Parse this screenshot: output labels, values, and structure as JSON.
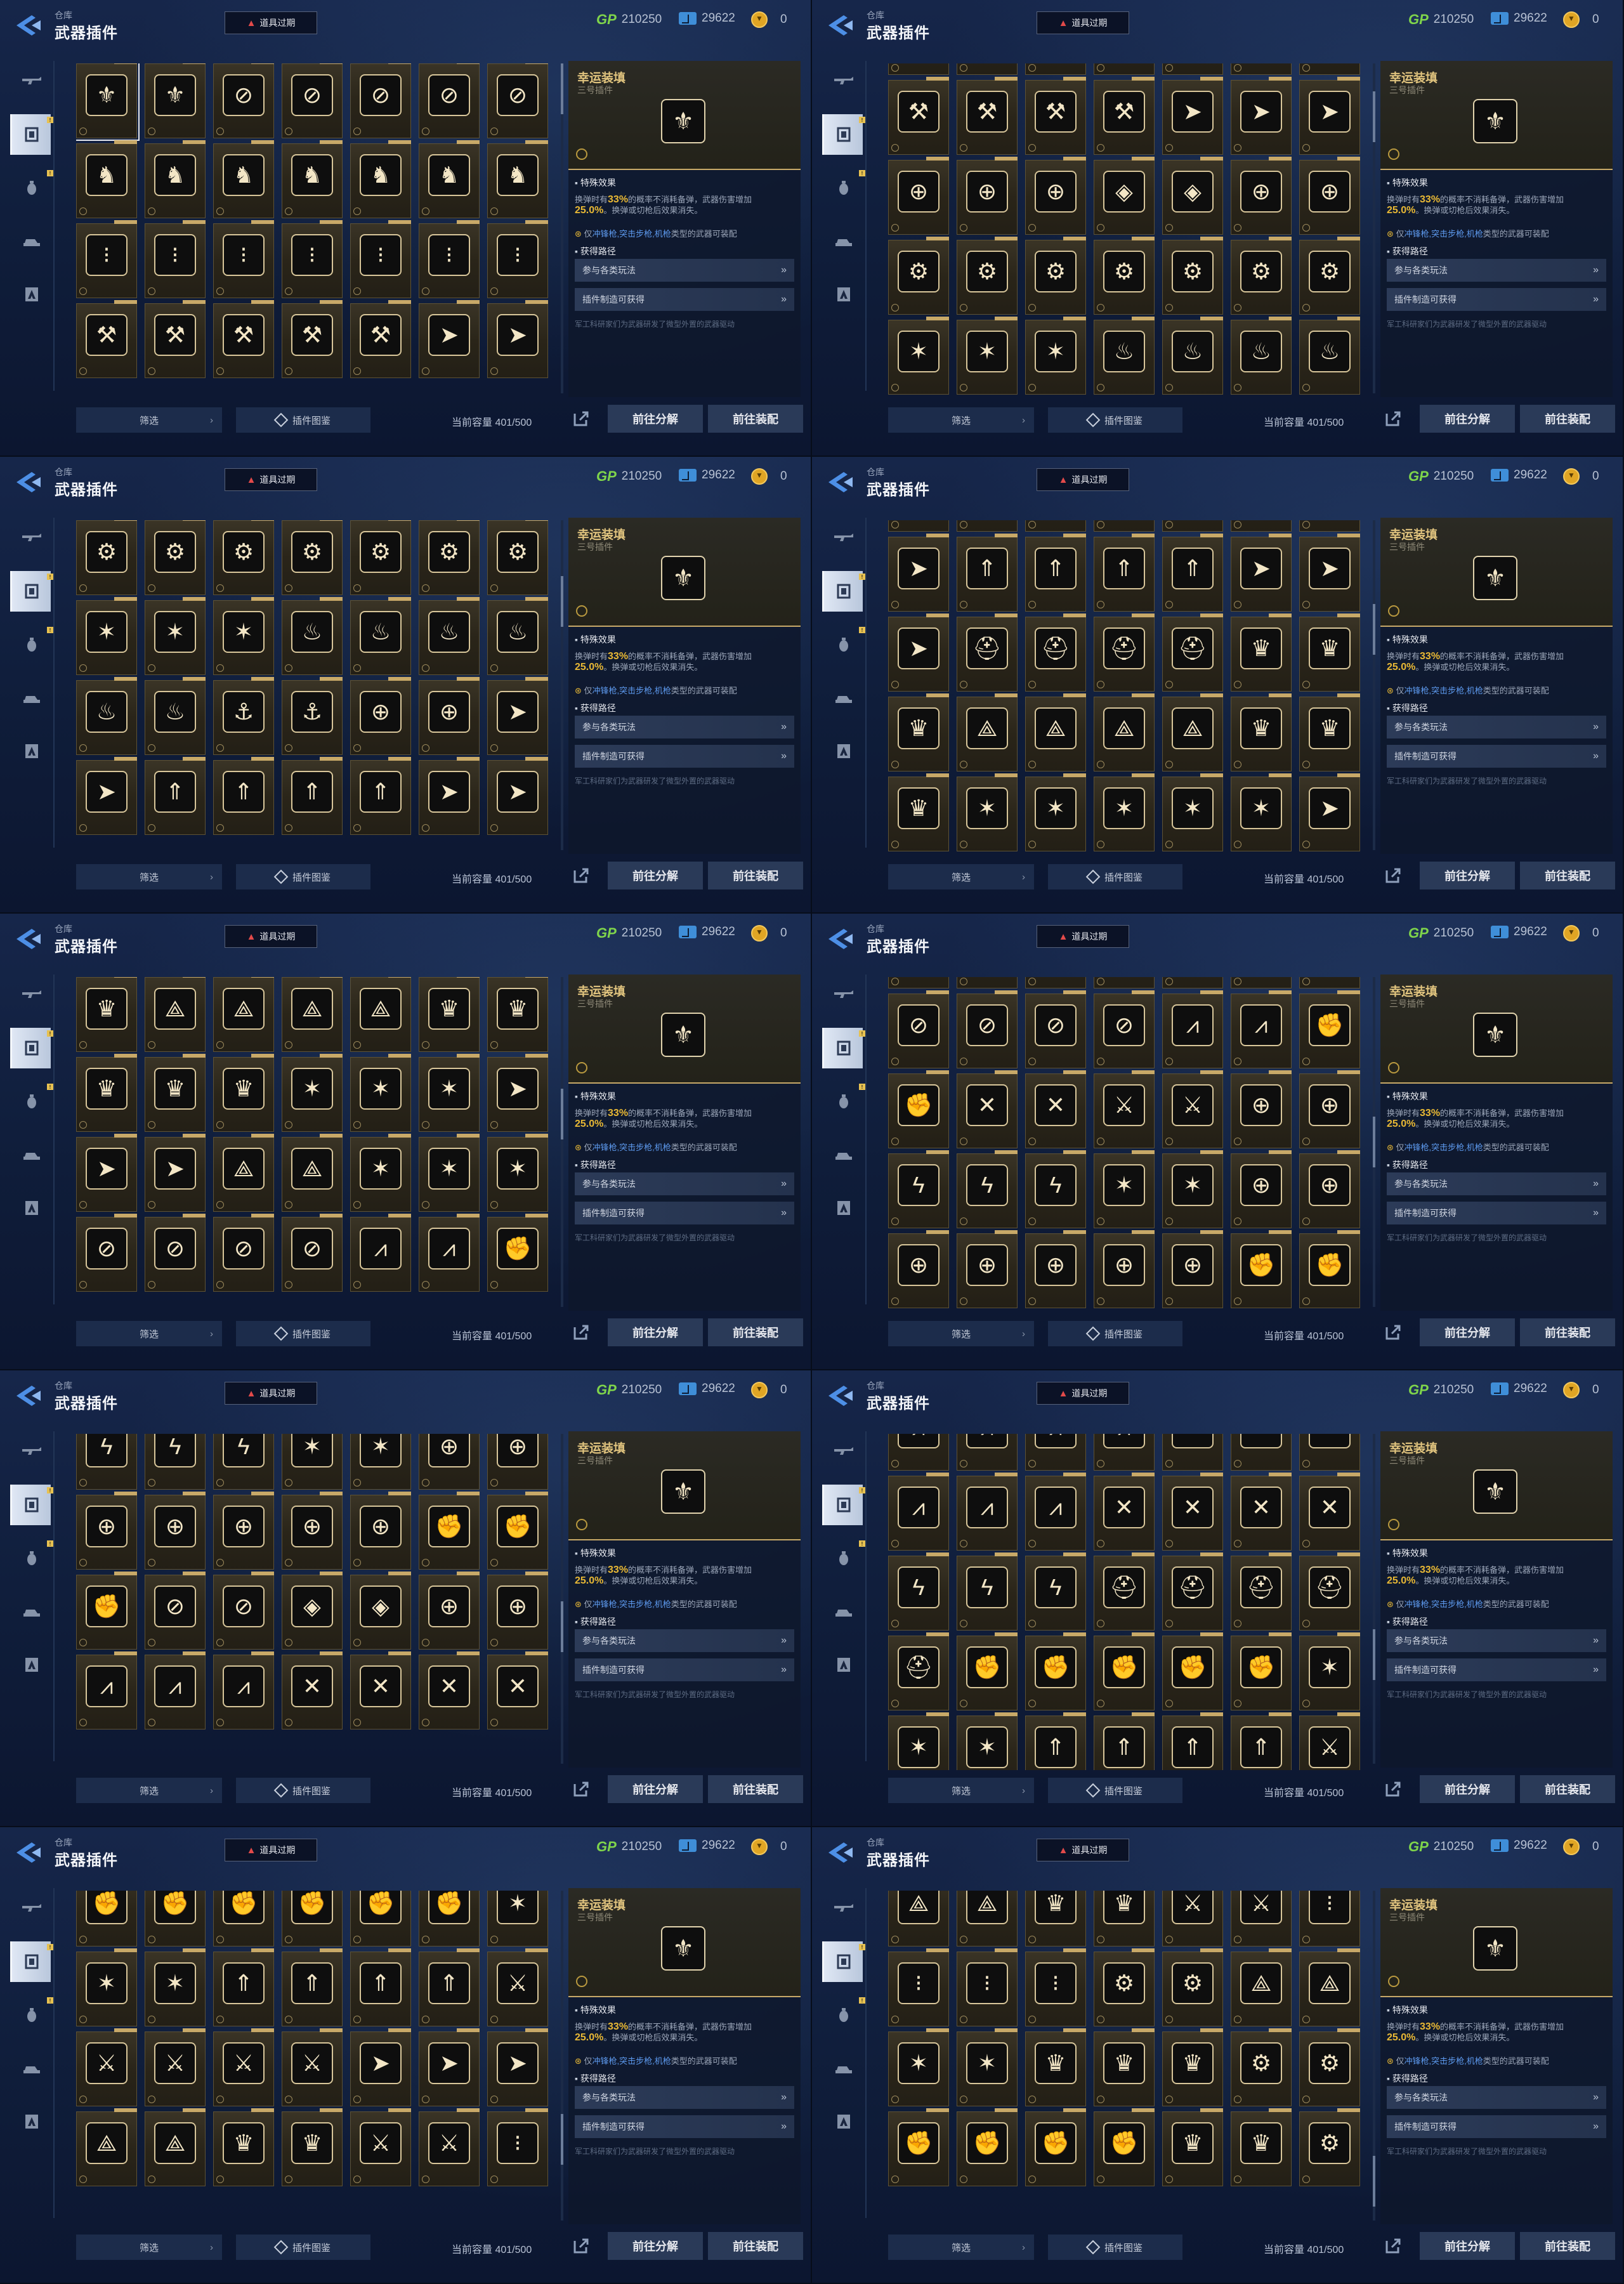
{
  "header": {
    "breadcrumb": "仓库",
    "title": "武器插件",
    "expired_label": "道具过期",
    "gp_label": "GP",
    "gp_value": "210250",
    "ticket_value": "29622",
    "coin_value": "0"
  },
  "sidebar": {
    "badge": "!",
    "tabs": [
      {
        "icon": "rifle-icon"
      },
      {
        "icon": "plugin-chip-icon"
      },
      {
        "icon": "grenade-icon"
      },
      {
        "icon": "vehicle-icon"
      },
      {
        "icon": "emblem-icon"
      }
    ]
  },
  "glyphs": {
    "wing": "⚜",
    "shield": "⊘",
    "soldier": "♞",
    "bullets": "⁝",
    "gun": "⚒",
    "arrow": "➤",
    "target": "⊕",
    "diamond": "◈",
    "robot": "⚙",
    "star": "✶",
    "flame": "♨",
    "anchor": "⚓",
    "chevron": "⇑",
    "helmet": "⛑",
    "triangle": "⟁",
    "claw": "⩘",
    "cross": "✕",
    "bolt": "ϟ",
    "fist": "✊",
    "sword": "⚔",
    "crown": "♛"
  },
  "panels": [
    {
      "offset": 0,
      "selected": 0,
      "scroll": 0.0,
      "icons": [
        "wing",
        "wing",
        "shield",
        "shield",
        "shield",
        "shield",
        "shield",
        "soldier",
        "soldier",
        "soldier",
        "soldier",
        "soldier",
        "soldier",
        "soldier",
        "bullets",
        "bullets",
        "bullets",
        "bullets",
        "bullets",
        "bullets",
        "bullets",
        "gun",
        "gun",
        "gun",
        "gun",
        "gun",
        "arrow",
        "arrow"
      ]
    },
    {
      "offset": -100,
      "selected": -1,
      "scroll": 0.1,
      "icons": [
        "robot",
        "robot",
        "robot",
        "robot",
        "robot",
        "robot",
        "robot",
        "gun",
        "gun",
        "gun",
        "gun",
        "arrow",
        "arrow",
        "arrow",
        "target",
        "target",
        "target",
        "diamond",
        "diamond",
        "target",
        "target",
        "robot",
        "robot",
        "robot",
        "robot",
        "robot",
        "robot",
        "robot",
        "star",
        "star",
        "star",
        "flame",
        "flame",
        "flame",
        "flame"
      ]
    },
    {
      "offset": 0,
      "selected": -1,
      "scroll": 0.2,
      "icons": [
        "robot",
        "robot",
        "robot",
        "robot",
        "robot",
        "robot",
        "robot",
        "star",
        "star",
        "star",
        "flame",
        "flame",
        "flame",
        "flame",
        "flame",
        "flame",
        "anchor",
        "anchor",
        "target",
        "target",
        "arrow",
        "arrow",
        "chevron",
        "chevron",
        "chevron",
        "chevron",
        "arrow",
        "arrow"
      ]
    },
    {
      "offset": -100,
      "selected": -1,
      "scroll": 0.3,
      "icons": [
        "flame",
        "flame",
        "flame",
        "flame",
        "flame",
        "flame",
        "flame",
        "arrow",
        "chevron",
        "chevron",
        "chevron",
        "chevron",
        "arrow",
        "arrow",
        "arrow",
        "helmet",
        "helmet",
        "helmet",
        "helmet",
        "crown",
        "crown",
        "crown",
        "triangle",
        "triangle",
        "triangle",
        "triangle",
        "crown",
        "crown",
        "crown",
        "star",
        "star",
        "star",
        "star",
        "star",
        "arrow"
      ]
    },
    {
      "offset": 0,
      "selected": -1,
      "scroll": 0.4,
      "icons": [
        "crown",
        "triangle",
        "triangle",
        "triangle",
        "triangle",
        "crown",
        "crown",
        "crown",
        "crown",
        "crown",
        "star",
        "star",
        "star",
        "arrow",
        "arrow",
        "arrow",
        "triangle",
        "triangle",
        "star",
        "star",
        "star",
        "shield",
        "shield",
        "shield",
        "shield",
        "claw",
        "claw",
        "fist"
      ]
    },
    {
      "offset": -100,
      "selected": -1,
      "scroll": 0.5,
      "icons": [
        "shield",
        "shield",
        "shield",
        "shield",
        "shield",
        "claw",
        "fist",
        "shield",
        "shield",
        "shield",
        "shield",
        "claw",
        "claw",
        "fist",
        "fist",
        "cross",
        "cross",
        "sword",
        "sword",
        "target",
        "target",
        "bolt",
        "bolt",
        "bolt",
        "star",
        "star",
        "target",
        "target",
        "target",
        "target",
        "target",
        "target",
        "target",
        "fist",
        "fist"
      ]
    },
    {
      "offset": -30,
      "selected": -1,
      "scroll": 0.6,
      "icons": [
        "bolt",
        "bolt",
        "bolt",
        "star",
        "star",
        "target",
        "target",
        "target",
        "target",
        "target",
        "target",
        "target",
        "fist",
        "fist",
        "fist",
        "shield",
        "shield",
        "diamond",
        "diamond",
        "target",
        "target",
        "claw",
        "claw",
        "claw",
        "cross",
        "cross",
        "cross",
        "cross"
      ]
    },
    {
      "offset": -60,
      "selected": -1,
      "scroll": 0.7,
      "icons": [
        "claw",
        "claw",
        "claw",
        "claw",
        "cross",
        "cross",
        "cross",
        "claw",
        "claw",
        "claw",
        "cross",
        "cross",
        "cross",
        "cross",
        "bolt",
        "bolt",
        "bolt",
        "helmet",
        "helmet",
        "helmet",
        "helmet",
        "helmet",
        "fist",
        "fist",
        "fist",
        "fist",
        "fist",
        "star",
        "star",
        "star",
        "chevron",
        "chevron",
        "chevron",
        "chevron",
        "sword"
      ]
    },
    {
      "offset": -30,
      "selected": -1,
      "scroll": 0.8,
      "icons": [
        "fist",
        "fist",
        "fist",
        "fist",
        "fist",
        "fist",
        "star",
        "star",
        "star",
        "chevron",
        "chevron",
        "chevron",
        "chevron",
        "sword",
        "sword",
        "sword",
        "sword",
        "sword",
        "arrow",
        "arrow",
        "arrow",
        "triangle",
        "triangle",
        "crown",
        "crown",
        "sword",
        "sword",
        "bullets"
      ]
    },
    {
      "offset": -30,
      "selected": -1,
      "scroll": 0.95,
      "icons": [
        "triangle",
        "triangle",
        "crown",
        "crown",
        "sword",
        "sword",
        "bullets",
        "bullets",
        "bullets",
        "bullets",
        "robot",
        "robot",
        "triangle",
        "triangle",
        "star",
        "star",
        "crown",
        "crown",
        "crown",
        "robot",
        "robot",
        "fist",
        "fist",
        "fist",
        "fist",
        "crown",
        "crown",
        "robot"
      ]
    }
  ],
  "detail": {
    "name": "幸运装填",
    "subtitle": "三号插件",
    "icon": "wing",
    "effect_title": "特殊效果",
    "effect_pre": "换弹时有",
    "effect_pct": "33%",
    "effect_mid": "的概率不消耗备弹，武器伤害增加",
    "effect_val": "25.0%",
    "effect_post": "。换弹或切枪后效果消失。",
    "compat_pre": "仅",
    "compat_weapons": "冲锋枪,突击步枪,机枪",
    "compat_post": "类型的武器可装配",
    "source_title": "获得路径",
    "source_1": "参与各类玩法",
    "source_2": "插件制造可获得",
    "flavor": "军工科研家们为武器研发了微型外置的武器驱动"
  },
  "footer": {
    "filter_label": "筛选",
    "codex_label": "插件图鉴",
    "capacity_label": "当前容量 401/500",
    "dismantle_label": "前往分解",
    "equip_label": "前往装配"
  }
}
